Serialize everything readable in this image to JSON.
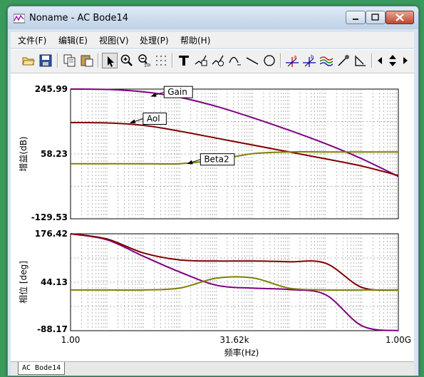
{
  "window": {
    "title": "Noname - AC Bode14",
    "controls": [
      "minimize",
      "maximize",
      "close"
    ]
  },
  "menu": [
    {
      "label": "文件(F)"
    },
    {
      "label": "编辑(E)"
    },
    {
      "label": "视图(V)"
    },
    {
      "label": "处理(P)"
    },
    {
      "label": "帮助(H)"
    }
  ],
  "toolbar": {
    "icons": [
      "open-folder-icon",
      "save-icon",
      "copy-icon",
      "paste-icon",
      "pointer-icon",
      "zoom-in-icon",
      "zoom-100-icon",
      "grid-icon",
      "text-icon",
      "tag-icon",
      "tag-alt-icon",
      "annotate-icon",
      "line-icon",
      "circle-icon",
      "cursor-a-icon",
      "cursor-b-icon",
      "wave-icon",
      "probe-icon",
      "slope-icon",
      "arrow-left-icon",
      "arrow-updown-icon",
      "arrow-right-icon"
    ],
    "zoom_badge": "100",
    "cursor_a": "a",
    "cursor_b": "b"
  },
  "chart_data": [
    {
      "type": "line",
      "panel": "top",
      "ylabel": "增益(dB)",
      "ylim": [
        -129.53,
        245.99
      ],
      "yticks": [
        "245.99",
        "58.23",
        "-129.53"
      ],
      "xscale": "log",
      "xlim": [
        1,
        1000000000
      ],
      "grid": true,
      "series": [
        {
          "name": "Gain",
          "color": "#800080",
          "x": [
            1,
            10,
            100,
            1000,
            10000,
            100000,
            1000000,
            10000000,
            100000000,
            1000000000
          ],
          "values": [
            245.99,
            245.0,
            238.0,
            222.0,
            196.0,
            163.0,
            127.0,
            88.0,
            44.0,
            -7.0
          ]
        },
        {
          "name": "Aol",
          "color": "#800000",
          "x": [
            1,
            10,
            100,
            1000,
            10000,
            100000,
            1000000,
            10000000,
            100000000,
            1000000000
          ],
          "values": [
            149.0,
            148.0,
            141.0,
            124.0,
            104.0,
            84.0,
            64.0,
            44.0,
            23.0,
            -4.0
          ]
        },
        {
          "name": "Beta2",
          "color": "#808000",
          "x": [
            1,
            10,
            100,
            1000,
            10000,
            100000,
            1000000,
            10000000,
            100000000,
            1000000000
          ],
          "values": [
            30.0,
            30.0,
            30.0,
            30.0,
            41.0,
            59.0,
            64.0,
            64.0,
            64.0,
            64.0
          ]
        }
      ]
    },
    {
      "type": "line",
      "panel": "bottom",
      "ylabel": "相位 [deg]",
      "xlabel": "频率(Hz)",
      "ylim": [
        -88.17,
        176.42
      ],
      "yticks": [
        "176.42",
        "44.13",
        "-88.17"
      ],
      "xticks": [
        "1.00",
        "31.62k",
        "1.00G"
      ],
      "xscale": "log",
      "xlim": [
        1,
        1000000000
      ],
      "grid": true,
      "series": [
        {
          "name": "Gain",
          "color": "#800080",
          "x": [
            1,
            10,
            100,
            1000,
            10000,
            100000,
            1000000,
            10000000,
            100000000,
            1000000000
          ],
          "values": [
            176.42,
            160.0,
            115.0,
            72.0,
            36.0,
            28.0,
            24.0,
            10.0,
            -75.0,
            -88.17
          ]
        },
        {
          "name": "Aol",
          "color": "#800000",
          "x": [
            1,
            10,
            100,
            1000,
            10000,
            100000,
            1000000,
            10000000,
            100000000,
            1000000000
          ],
          "values": [
            176.42,
            162.0,
            124.0,
            105.0,
            102.0,
            102.0,
            100.0,
            96.0,
            30.0,
            23.0
          ]
        },
        {
          "name": "Beta2",
          "color": "#808000",
          "x": [
            1,
            10,
            100,
            1000,
            10000,
            100000,
            1000000,
            10000000,
            100000000,
            1000000000
          ],
          "values": [
            23.0,
            23.0,
            23.0,
            28.0,
            55.0,
            56.0,
            28.0,
            23.0,
            23.0,
            23.0
          ]
        }
      ]
    }
  ],
  "annotations": [
    {
      "label": "Gain",
      "panel": "top",
      "x": 150,
      "y": 225
    },
    {
      "label": "Aol",
      "panel": "top",
      "x": 40,
      "y": 148
    },
    {
      "label": "Beta2",
      "panel": "top",
      "x": 1500,
      "y": 30
    }
  ],
  "tabs": [
    {
      "label": "AC Bode14",
      "active": true
    }
  ]
}
